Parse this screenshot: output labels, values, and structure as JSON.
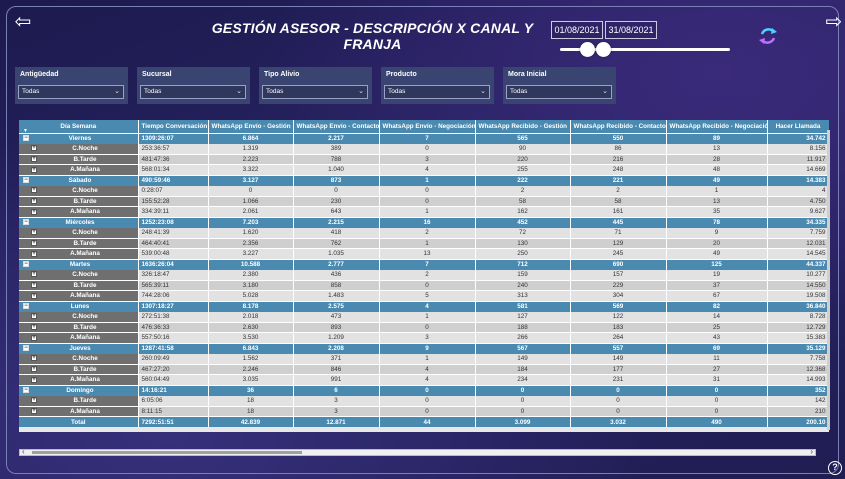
{
  "header": {
    "title": "GESTIÓN ASESOR - DESCRIPCIÓN X CANAL Y FRANJA",
    "date_start": "01/08/2021",
    "date_end": "31/08/2021",
    "slider_range": [
      0,
      1
    ]
  },
  "filters": [
    {
      "label": "Antigüedad",
      "value": "Todas"
    },
    {
      "label": "Sucursal",
      "value": "Todas"
    },
    {
      "label": "Tipo Alivio",
      "value": "Todas"
    },
    {
      "label": "Producto",
      "value": "Todas"
    },
    {
      "label": "Mora Inicial",
      "value": "Todas"
    }
  ],
  "table": {
    "columns": [
      "Día Semana",
      "Tiempo Conversación",
      "WhatsApp Envío - Gestión",
      "WhatsApp Envío - Contacto",
      "WhatsApp Envío - Negociación",
      "WhatsApp Recibido - Gestión",
      "WhatsApp Recibido - Contacto",
      "WhatsApp Recibido - Negociación",
      "Hacer Llamada"
    ],
    "rows": [
      {
        "type": "day",
        "cells": [
          "Viernes",
          "1309:26:07",
          "6.864",
          "2.217",
          "7",
          "565",
          "550",
          "89",
          "34.742"
        ]
      },
      {
        "type": "sub",
        "cells": [
          "C.Noche",
          "253:36:57",
          "1.319",
          "389",
          "0",
          "90",
          "86",
          "13",
          "8.156"
        ]
      },
      {
        "type": "sub",
        "cells": [
          "B.Tarde",
          "481:47:36",
          "2.223",
          "788",
          "3",
          "220",
          "216",
          "28",
          "11.917"
        ]
      },
      {
        "type": "sub",
        "cells": [
          "A.Mañana",
          "568:01:34",
          "3.322",
          "1.040",
          "4",
          "255",
          "248",
          "48",
          "14.669"
        ]
      },
      {
        "type": "day",
        "cells": [
          "Sábado",
          "490:59:46",
          "3.127",
          "873",
          "1",
          "222",
          "221",
          "49",
          "14.383"
        ]
      },
      {
        "type": "sub",
        "cells": [
          "C.Noche",
          "0:28:07",
          "0",
          "0",
          "0",
          "2",
          "2",
          "1",
          "4"
        ]
      },
      {
        "type": "sub",
        "cells": [
          "B.Tarde",
          "155:52:28",
          "1.066",
          "230",
          "0",
          "58",
          "58",
          "13",
          "4.750"
        ]
      },
      {
        "type": "sub",
        "cells": [
          "A.Mañana",
          "334:39:11",
          "2.061",
          "643",
          "1",
          "162",
          "161",
          "35",
          "9.627"
        ]
      },
      {
        "type": "day",
        "cells": [
          "Miércoles",
          "1252:23:08",
          "7.203",
          "2.215",
          "16",
          "452",
          "445",
          "78",
          "34.335"
        ]
      },
      {
        "type": "sub",
        "cells": [
          "C.Noche",
          "248:41:39",
          "1.620",
          "418",
          "2",
          "72",
          "71",
          "9",
          "7.759"
        ]
      },
      {
        "type": "sub",
        "cells": [
          "B.Tarde",
          "464:40:41",
          "2.356",
          "762",
          "1",
          "130",
          "129",
          "20",
          "12.031"
        ]
      },
      {
        "type": "sub",
        "cells": [
          "A.Mañana",
          "539:00:48",
          "3.227",
          "1.035",
          "13",
          "250",
          "245",
          "49",
          "14.545"
        ]
      },
      {
        "type": "day",
        "cells": [
          "Martes",
          "1636:26:04",
          "10.588",
          "2.777",
          "7",
          "712",
          "690",
          "125",
          "44.337"
        ]
      },
      {
        "type": "sub",
        "cells": [
          "C.Noche",
          "326:18:47",
          "2.380",
          "436",
          "2",
          "159",
          "157",
          "19",
          "10.277"
        ]
      },
      {
        "type": "sub",
        "cells": [
          "B.Tarde",
          "565:39:11",
          "3.180",
          "858",
          "0",
          "240",
          "229",
          "37",
          "14.550"
        ]
      },
      {
        "type": "sub",
        "cells": [
          "A.Mañana",
          "744:28:06",
          "5.028",
          "1.483",
          "5",
          "313",
          "304",
          "67",
          "19.508"
        ]
      },
      {
        "type": "day",
        "cells": [
          "Lunes",
          "1307:18:27",
          "8.178",
          "2.575",
          "4",
          "581",
          "569",
          "82",
          "36.840"
        ]
      },
      {
        "type": "sub",
        "cells": [
          "C.Noche",
          "272:51:38",
          "2.018",
          "473",
          "1",
          "127",
          "122",
          "14",
          "8.728"
        ]
      },
      {
        "type": "sub",
        "cells": [
          "B.Tarde",
          "476:36:33",
          "2.630",
          "893",
          "0",
          "188",
          "183",
          "25",
          "12.729"
        ]
      },
      {
        "type": "sub",
        "cells": [
          "A.Mañana",
          "557:50:16",
          "3.530",
          "1.209",
          "3",
          "266",
          "264",
          "43",
          "15.383"
        ]
      },
      {
        "type": "day",
        "cells": [
          "Jueves",
          "1287:41:58",
          "6.843",
          "2.208",
          "9",
          "567",
          "557",
          "69",
          "35.129"
        ]
      },
      {
        "type": "sub",
        "cells": [
          "C.Noche",
          "260:09:49",
          "1.562",
          "371",
          "1",
          "149",
          "149",
          "11",
          "7.758"
        ]
      },
      {
        "type": "sub",
        "cells": [
          "B.Tarde",
          "467:27:20",
          "2.246",
          "846",
          "4",
          "184",
          "177",
          "27",
          "12.368"
        ]
      },
      {
        "type": "sub",
        "cells": [
          "A.Mañana",
          "560:04:49",
          "3.035",
          "991",
          "4",
          "234",
          "231",
          "31",
          "14.993"
        ]
      },
      {
        "type": "day",
        "cells": [
          "Domingo",
          "14:16:21",
          "36",
          "6",
          "0",
          "0",
          "0",
          "0",
          "352"
        ]
      },
      {
        "type": "sub",
        "cells": [
          "B.Tarde",
          "6:05:06",
          "18",
          "3",
          "0",
          "0",
          "0",
          "0",
          "142"
        ]
      },
      {
        "type": "sub",
        "cells": [
          "A.Mañana",
          "8:11:15",
          "18",
          "3",
          "0",
          "0",
          "0",
          "0",
          "210"
        ]
      }
    ],
    "total": [
      "Total",
      "7292:51:51",
      "42.839",
      "12.871",
      "44",
      "3.099",
      "3.032",
      "490",
      "200.10"
    ]
  },
  "icons": {
    "back": "arrow-left-icon",
    "forward": "arrow-right-icon",
    "refresh": "refresh-icon",
    "help": "help-icon"
  },
  "colors": {
    "header_blue": "#4a8ab0",
    "sub_label_gray": "#6f6f6f",
    "background": "#1b1d4a"
  }
}
